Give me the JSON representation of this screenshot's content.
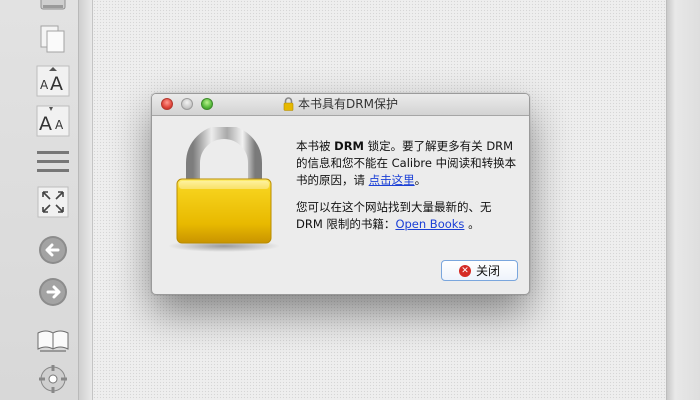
{
  "toolbar": {
    "tools": [
      {
        "icon": "book-icon"
      },
      {
        "icon": "copy-icon"
      },
      {
        "icon": "font-larger-icon"
      },
      {
        "icon": "font-smaller-icon"
      },
      {
        "icon": "table-of-contents-icon"
      },
      {
        "icon": "fullscreen-icon"
      },
      {
        "icon": "back-arrow-icon"
      },
      {
        "icon": "forward-arrow-icon"
      },
      {
        "icon": "open-book-icon"
      },
      {
        "icon": "preferences-icon"
      }
    ]
  },
  "dialog": {
    "title": "本书具有DRM保护",
    "message1": {
      "part1": "本书被 ",
      "bold": "DRM",
      "part2": " 锁定。要了解更多有关 DRM 的信息和您不能在 Calibre 中阅读和转换本书的原因，请 ",
      "link": "点击这里",
      "part3": "。"
    },
    "message2": {
      "part1": "您可以在这个网站找到大量最新的、无 DRM 限制的书籍：",
      "link": "Open Books",
      "part2": " 。"
    },
    "close_label": "关闭"
  },
  "colors": {
    "link": "#1a3fd6",
    "close_icon": "#d52a24",
    "padlock_gold": "#f2c500"
  }
}
